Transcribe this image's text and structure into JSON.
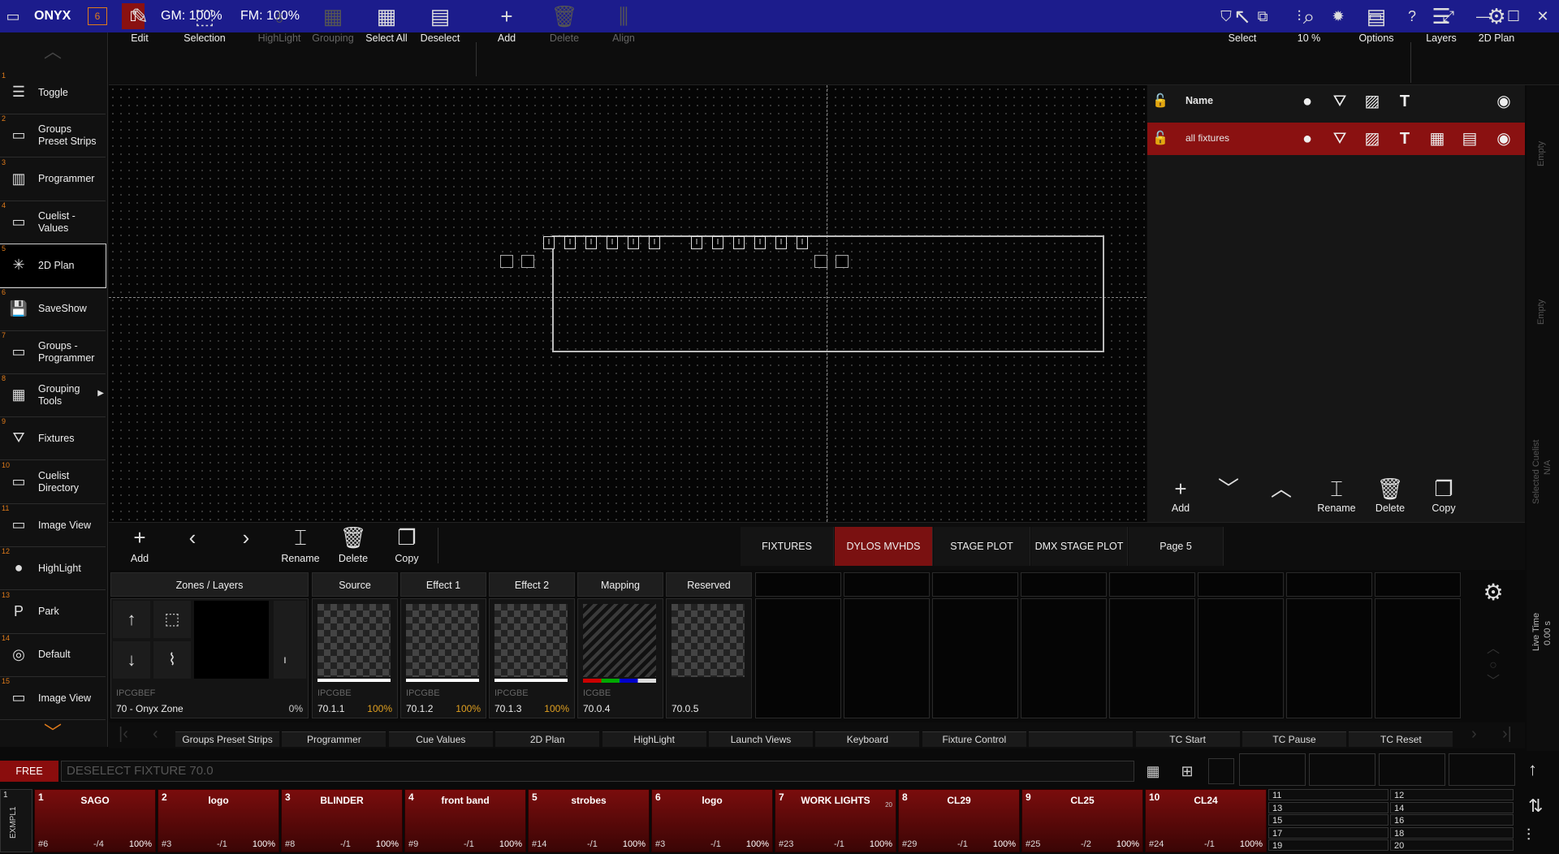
{
  "titlebar": {
    "app_name": "ONYX",
    "gm": "GM: 100%",
    "fm": "FM: 100%"
  },
  "sidebar": {
    "items": [
      {
        "num": "1",
        "label": "Toggle",
        "icon": "toggle-icon"
      },
      {
        "num": "2",
        "label": "Groups Preset Strips",
        "icon": "window-icon"
      },
      {
        "num": "3",
        "label": "Programmer",
        "icon": "bars-icon"
      },
      {
        "num": "4",
        "label": "Cuelist - Values",
        "icon": "window-icon"
      },
      {
        "num": "5",
        "label": "2D Plan",
        "icon": "plan-icon"
      },
      {
        "num": "6",
        "label": "SaveShow",
        "icon": "save-icon"
      },
      {
        "num": "7",
        "label": "Groups - Programmer",
        "icon": "window-icon"
      },
      {
        "num": "8",
        "label": "Grouping Tools",
        "icon": "grid-icon"
      },
      {
        "num": "9",
        "label": "Fixtures",
        "icon": "fixture-icon"
      },
      {
        "num": "10",
        "label": "Cuelist Directory",
        "icon": "window-icon"
      },
      {
        "num": "11",
        "label": "Image View",
        "icon": "window-icon"
      },
      {
        "num": "12",
        "label": "HighLight",
        "icon": "bulb-icon"
      },
      {
        "num": "13",
        "label": "Park",
        "icon": "park-icon"
      },
      {
        "num": "14",
        "label": "Default",
        "icon": "default-icon"
      },
      {
        "num": "15",
        "label": "Image View",
        "icon": "window-icon"
      }
    ]
  },
  "toolbar": {
    "edit": "Edit",
    "selection": "Selection",
    "highlight": "HighLight",
    "grouping": "Grouping",
    "select_all": "Select All",
    "deselect": "Deselect",
    "add": "Add",
    "delete": "Delete",
    "align": "Align",
    "select": "Select",
    "zoom": "10 %",
    "options": "Options",
    "layers": "Layers",
    "plan": "2D Plan"
  },
  "layers": {
    "header_name": "Name",
    "row": "all fixtures",
    "buttons": {
      "add": "Add",
      "rename": "Rename",
      "delete": "Delete",
      "copy": "Copy"
    }
  },
  "right_strip": {
    "empty1": "Empty",
    "empty2": "Empty",
    "selected_cuelist": "Selected Cuelist",
    "na": "N/A",
    "live_time": "Live Time",
    "live_val": "0.00 s"
  },
  "bottom_bar": {
    "add": "Add",
    "rename": "Rename",
    "delete": "Delete",
    "copy": "Copy",
    "tabs": [
      "FIXTURES",
      "DYLOS MVHDS",
      "STAGE PLOT",
      "DMX STAGE PLOT",
      "Page 5"
    ]
  },
  "zones": {
    "headers": [
      "Zones / Layers",
      "Source",
      "Effect 1",
      "Effect 2",
      "Mapping",
      "Reserved"
    ],
    "zone_sub": "IPCGBEF",
    "zone_name": "70 - Onyx Zone",
    "zone_pct": "0%",
    "cells": [
      {
        "sub": "IPCGBE",
        "val": "70.1.1",
        "pct": "100%"
      },
      {
        "sub": "IPCGBE",
        "val": "70.1.2",
        "pct": "100%"
      },
      {
        "sub": "IPCGBE",
        "val": "70.1.3",
        "pct": "100%"
      },
      {
        "sub": "ICGBE",
        "val": "70.0.4",
        "pct": ""
      },
      {
        "sub": "",
        "val": "70.0.5",
        "pct": ""
      }
    ]
  },
  "macros": [
    "Groups Preset Strips",
    "Programmer",
    "Cue Values",
    "2D Plan",
    "HighLight",
    "Launch Views",
    "Keyboard",
    "Fixture Control",
    "",
    "TC Start",
    "TC Pause",
    "TC Reset"
  ],
  "command": {
    "mode": "FREE",
    "text": "DESELECT FIXTURE 70.0"
  },
  "playbacks": {
    "bank_label": "EXMPL1",
    "bank_num": "1",
    "items": [
      {
        "num": "1",
        "name": "SAGO",
        "fix": "#6",
        "cue": "-/4",
        "pct": "100%"
      },
      {
        "num": "2",
        "name": "logo",
        "fix": "#3",
        "cue": "-/1",
        "pct": "100%"
      },
      {
        "num": "3",
        "name": "BLINDER",
        "fix": "#8",
        "cue": "-/1",
        "pct": "100%"
      },
      {
        "num": "4",
        "name": "front band",
        "fix": "#9",
        "cue": "-/1",
        "pct": "100%"
      },
      {
        "num": "5",
        "name": "strobes",
        "fix": "#14",
        "cue": "-/1",
        "pct": "100%"
      },
      {
        "num": "6",
        "name": "logo",
        "fix": "#3",
        "cue": "-/1",
        "pct": "100%"
      },
      {
        "num": "7",
        "name": "WORK LIGHTS",
        "fix": "#23",
        "cue": "-/1",
        "pct": "100%",
        "extra": "20"
      },
      {
        "num": "8",
        "name": "CL29",
        "fix": "#29",
        "cue": "-/1",
        "pct": "100%"
      },
      {
        "num": "9",
        "name": "CL25",
        "fix": "#25",
        "cue": "-/2",
        "pct": "100%"
      },
      {
        "num": "10",
        "name": "CL24",
        "fix": "#24",
        "cue": "-/1",
        "pct": "100%"
      }
    ],
    "mini_left": [
      "11",
      "13",
      "15",
      "17",
      "19"
    ],
    "mini_right": [
      "12",
      "14",
      "16",
      "18",
      "20"
    ]
  },
  "colors": {
    "titlebar": "#1c1c8c",
    "active_red": "#8a1111",
    "accent_orange": "#e07b1a"
  }
}
